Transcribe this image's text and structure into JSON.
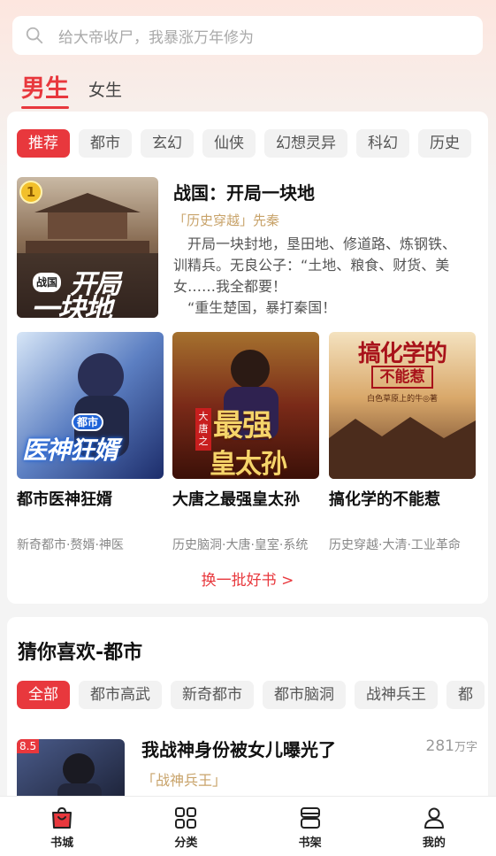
{
  "search": {
    "placeholder": "给大帝收尸，我暴涨万年修为",
    "icon": "search-icon"
  },
  "gender_tabs": [
    {
      "label": "男生",
      "active": true
    },
    {
      "label": "女生",
      "active": false
    }
  ],
  "categories": [
    "推荐",
    "都市",
    "玄幻",
    "仙侠",
    "幻想灵异",
    "科幻",
    "历史"
  ],
  "featured": {
    "rank": "1",
    "title": "战国：开局一块地",
    "tag_open": "「历史穿越」",
    "tag_era": "先秦",
    "desc_lines": [
      "开局一块封地，垦田地、修道路、炼钢铁、",
      "训精兵。无良公子：“土地、粮食、财货、美",
      "女……我全都要！",
      "“重生楚国，暴打秦国！"
    ],
    "cover_text": {
      "badge": "战国",
      "line1": "开局",
      "line2": "一块地"
    }
  },
  "grid_books": [
    {
      "title": "都市医神狂婿",
      "tags": "新奇都市·赘婿·神医",
      "cover_text": {
        "badge": "都市",
        "main": "医神狂婿"
      }
    },
    {
      "title": "大唐之最强皇太孙",
      "tags": "历史脑洞·大唐·皇室·系统",
      "cover_text": {
        "badge": "大唐之",
        "main": "最强",
        "sub": "皇太孙"
      }
    },
    {
      "title": "搞化学的不能惹",
      "tags": "历史穿越·大清·工业革命",
      "cover_text": {
        "main": "搞化学的",
        "sub": "不能惹",
        "author": "白色草原上的牛◎著"
      }
    }
  ],
  "refresh_label": "换一批好书 >",
  "guess": {
    "title": "猜你喜欢-都市",
    "chips": [
      "全部",
      "都市高武",
      "新奇都市",
      "都市脑洞",
      "战神兵王",
      "都"
    ],
    "book": {
      "title": "我战神身份被女儿曝光了",
      "score": "8.5",
      "word_count": "281",
      "word_unit": "万字",
      "tag": "「战神兵王」"
    }
  },
  "bottom_nav": [
    {
      "label": "书城",
      "icon": "bookstore-icon",
      "active": true
    },
    {
      "label": "分类",
      "icon": "category-icon",
      "active": false
    },
    {
      "label": "书架",
      "icon": "bookshelf-icon",
      "active": false
    },
    {
      "label": "我的",
      "icon": "profile-icon",
      "active": false
    }
  ],
  "colors": {
    "accent": "#e8383d",
    "tag_gold": "#c8a36a",
    "background": "#f4f4f4"
  }
}
